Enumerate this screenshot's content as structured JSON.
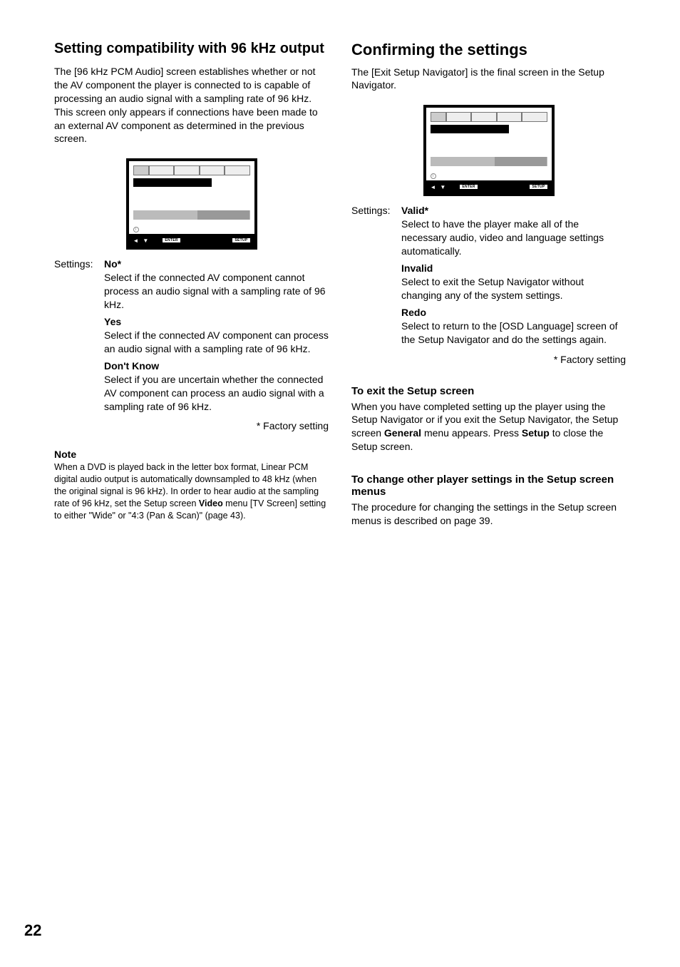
{
  "page_number": "22",
  "left": {
    "title": "Setting compatibility with 96 kHz output",
    "intro": "The [96 kHz PCM Audio] screen establishes whether or not the AV component the player is connected to is capable of processing an audio signal with a sampling rate of 96 kHz. This screen only appears if connections have been made to an external AV component as determined in the previous screen.",
    "settings_label": "Settings:",
    "options": [
      {
        "title": "No*",
        "desc": "Select if the connected AV component cannot process an audio signal with a sampling rate of 96 kHz."
      },
      {
        "title": "Yes",
        "desc": "Select if the connected AV component can process an audio signal with a sampling rate of 96 kHz."
      },
      {
        "title": "Don't Know",
        "desc": "Select if you are uncertain whether the connected AV component can process an audio signal with a sampling rate of 96 kHz."
      }
    ],
    "factory": "* Factory setting",
    "note_title": "Note",
    "note_pre": "When a DVD is played back in the letter box format, Linear PCM digital audio output is automatically downsampled to 48 kHz (when the original signal is 96 kHz). In order to hear audio at the sampling rate of 96 kHz, set the Setup screen ",
    "note_bold": "Video",
    "note_post": " menu [TV Screen] setting to either \"Wide\" or \"4:3 (Pan & Scan)\" (page 43)."
  },
  "right": {
    "title": "Confirming the settings",
    "intro": "The [Exit Setup Navigator] is the final screen in the Setup Navigator.",
    "settings_label": "Settings:",
    "options": [
      {
        "title": "Valid*",
        "desc": "Select to have the player make all of the necessary audio, video and language settings automatically."
      },
      {
        "title": "Invalid",
        "desc": "Select to exit the Setup Navigator without changing any of the system settings."
      },
      {
        "title": "Redo",
        "desc": "Select to return to the [OSD Language] screen of the Setup Navigator and do the settings again."
      }
    ],
    "factory": "* Factory setting",
    "exit_head": "To exit the Setup screen",
    "exit_pre": "When you have completed setting up the player using the Setup Navigator or if you exit the Setup Navigator, the Setup screen ",
    "exit_b1": "General",
    "exit_mid": " menu appears. Press ",
    "exit_b2": "Setup",
    "exit_post": " to close the Setup screen.",
    "change_head": "To change other player settings in the Setup screen menus",
    "change_text": "The procedure for changing the settings in the Setup screen menus is described on page 39."
  },
  "osd_buttons": {
    "enter": "ENTER",
    "setup": "SETUP"
  }
}
